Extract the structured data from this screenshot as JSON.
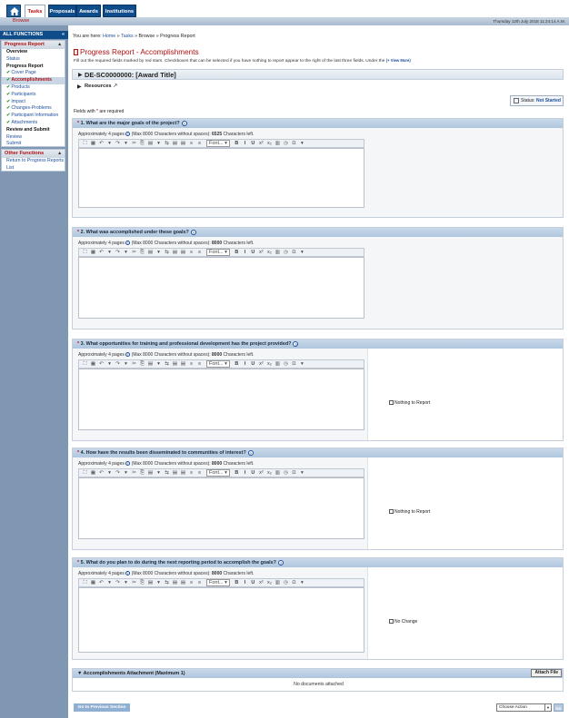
{
  "topnav": {
    "tabs": [
      "Tasks",
      "Proposals",
      "Awards",
      "Institutions"
    ],
    "subtab": "Browse",
    "datetime": "Thursday 12th July 2018 11:24:14 A.M."
  },
  "sidebar": {
    "header": "ALL FUNCTIONS",
    "header_icon": "double-chevron-left-icon",
    "progress_report": {
      "title": "Progress Report",
      "items": [
        {
          "label": "Overview",
          "style": "bold"
        },
        {
          "label": "Status",
          "style": "link"
        },
        {
          "label": "Progress Report",
          "style": "bold"
        },
        {
          "label": "Cover Page",
          "style": "check"
        },
        {
          "label": "Accomplishments",
          "style": "selected-check"
        },
        {
          "label": "Products",
          "style": "check"
        },
        {
          "label": "Participants",
          "style": "check"
        },
        {
          "label": "Impact",
          "style": "check"
        },
        {
          "label": "Changes-Problems",
          "style": "check"
        },
        {
          "label": "Participant Information",
          "style": "check"
        },
        {
          "label": "Attachments",
          "style": "check"
        },
        {
          "label": "Review and Submit",
          "style": "bold"
        },
        {
          "label": "Review",
          "style": "link"
        },
        {
          "label": "Submit",
          "style": "link"
        }
      ]
    },
    "other_functions": {
      "title": "Other Functions",
      "items": [
        "Return to Progress Reports",
        "List"
      ]
    }
  },
  "breadcrumb": {
    "prefix": "You are here:",
    "home": "Home",
    "tasks": "Tasks",
    "browse": "Browse",
    "current": "Progress Report",
    "sep": "»"
  },
  "page": {
    "title": "Progress Report - Accomplishments",
    "intro": "Fill out the required fields marked by red stars. Checkboxes that can be selected if you have nothing to report appear to the right of the last three fields. Under the",
    "view_more": "(+ View More)",
    "award_title": "DE-SC0000000: [Award Title]",
    "resources": "Resources",
    "status_label": "Status:",
    "status_value": "Not Started",
    "required_prefix": "Fields with",
    "required_suffix": "are required"
  },
  "editor_common": {
    "approx_prefix": "Approximately 4 pages",
    "approx_mid": "(Max 8000 Characters without spaces):",
    "chars_left_suffix": "Characters left.",
    "font_label": "Font..."
  },
  "sections": [
    {
      "number": "1.",
      "question": "What are the major goals of the project?",
      "chars_left": "6525",
      "checkbox": ""
    },
    {
      "number": "2.",
      "question": "What was accomplished under these goals?",
      "chars_left": "8000",
      "checkbox": ""
    },
    {
      "number": "3.",
      "question": "What opportunities for training and professional development has the project provided?",
      "chars_left": "8000",
      "checkbox": "Nothing to Report"
    },
    {
      "number": "4.",
      "question": "How have the results been disseminated to communities of interest?",
      "chars_left": "8000",
      "checkbox": "Nothing to Report"
    },
    {
      "number": "5.",
      "question": "What do you plan to do during the next reporting period to accomplish the goals?",
      "chars_left": "8000",
      "checkbox": "No Change"
    }
  ],
  "attachment": {
    "title": "Accomplishments Attachment (Maximum 1)",
    "button": "Attach File",
    "empty": "No documents attached"
  },
  "footer": {
    "prev_button": "Go to Previous Section",
    "action_select": "Choose Action",
    "go_button": "Go"
  },
  "colors": {
    "brand_blue": "#0f4d8a",
    "accent_red": "#b20f0f",
    "sidebar_bg": "#7f97b3",
    "section_header": "#b9cee4"
  }
}
